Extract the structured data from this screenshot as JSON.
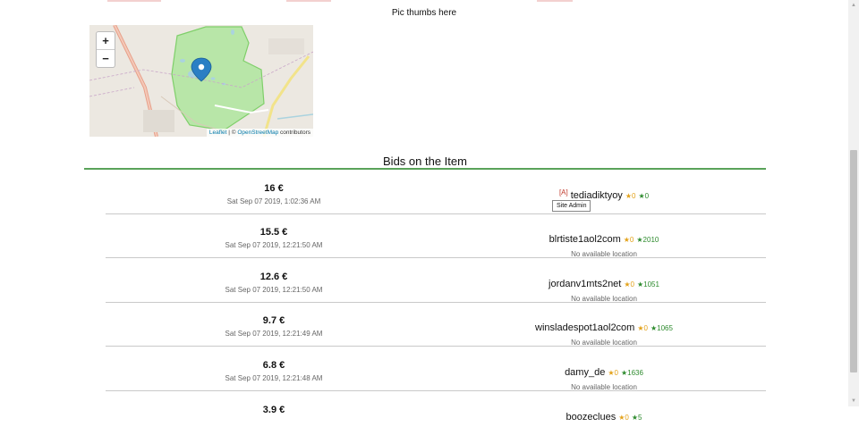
{
  "page": {
    "pic_thumbs_text": "Pic thumbs here",
    "bids_title": "Bids on the Item"
  },
  "map": {
    "zoom_in": "+",
    "zoom_out": "−",
    "attribution": {
      "leaflet": "Leaflet",
      "sep": " | © ",
      "osm": "OpenStreetMap",
      "suffix": " contributors"
    },
    "colors": {
      "park": "#b8e6a8",
      "park_border": "#7fcf6a",
      "road": "#e8a08a",
      "marker": "#2a7fc4"
    }
  },
  "bids": [
    {
      "amount": "16 €",
      "date": "Sat Sep 07 2019, 1:02:36 AM",
      "admin_tag": "[A]",
      "username": "tediadiktyoy",
      "stars_yellow": "★0",
      "stars_green": "★0",
      "location": ""
    },
    {
      "amount": "15.5 €",
      "date": "Sat Sep 07 2019, 12:21:50 AM",
      "admin_tag": "",
      "username": "blrtiste1aol2com",
      "stars_yellow": "★0",
      "stars_green": "★2010",
      "location": "No available location"
    },
    {
      "amount": "12.6 €",
      "date": "Sat Sep 07 2019, 12:21:50 AM",
      "admin_tag": "",
      "username": "jordanv1mts2net",
      "stars_yellow": "★0",
      "stars_green": "★1051",
      "location": "No available location"
    },
    {
      "amount": "9.7 €",
      "date": "Sat Sep 07 2019, 12:21:49 AM",
      "admin_tag": "",
      "username": "winsladespot1aol2com",
      "stars_yellow": "★0",
      "stars_green": "★1065",
      "location": "No available location"
    },
    {
      "amount": "6.8 €",
      "date": "Sat Sep 07 2019, 12:21:48 AM",
      "admin_tag": "",
      "username": "damy_de",
      "stars_yellow": "★0",
      "stars_green": "★1636",
      "location": "No available location"
    },
    {
      "amount": "3.9 €",
      "date": "",
      "admin_tag": "",
      "username": "boozeclues",
      "stars_yellow": "★0",
      "stars_green": "★5",
      "location": ""
    }
  ],
  "tooltip": {
    "text": "Site Admin"
  },
  "scrollbar": {
    "up_arrow": "▲",
    "down_arrow": "▼"
  }
}
